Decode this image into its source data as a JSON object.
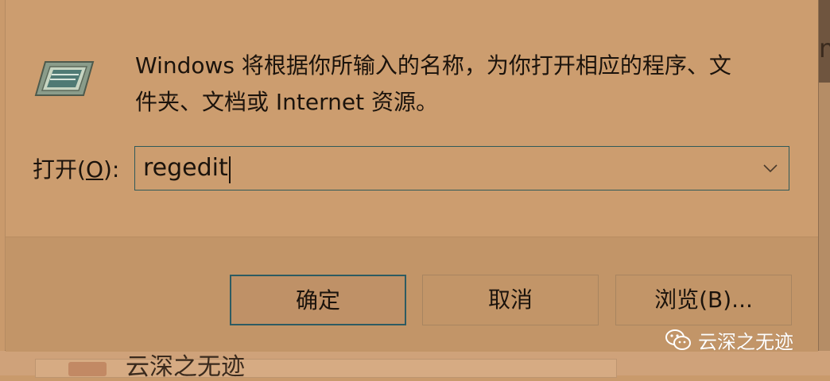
{
  "dialog": {
    "prompt_line1": "Windows 将根据你所输入的名称，为你打开相应的程序、文",
    "prompt_line2": "件夹、文档或 Internet 资源。",
    "open_label_prefix": "打开(",
    "open_label_accel": "O",
    "open_label_suffix": "):",
    "open_value": "regedit"
  },
  "buttons": {
    "ok_label": "确定",
    "cancel_label": "取消",
    "browse_label": "浏览(B)..."
  },
  "background": {
    "partial_text_right": "m",
    "partial_text_bottom": "云深之无迹"
  },
  "watermark": {
    "text": "云深之无迹",
    "icon": "wechat-icon"
  },
  "colors": {
    "accent_border": "#2d5b62",
    "dialog_bg": "#cc9d6f",
    "footer_bg": "#c29568"
  }
}
